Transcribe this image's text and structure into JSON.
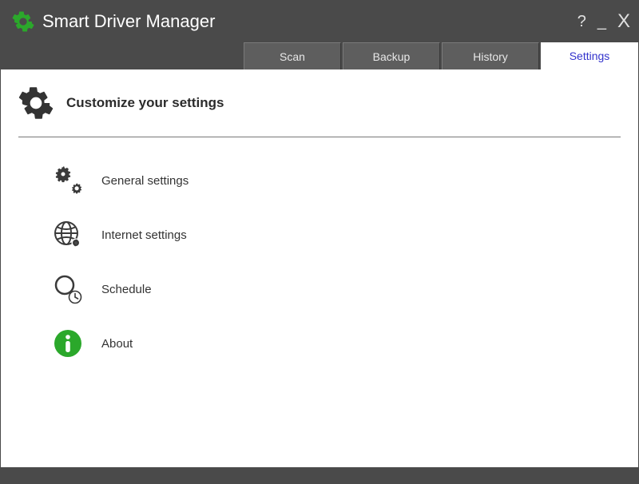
{
  "app": {
    "title": "Smart Driver Manager"
  },
  "tabs": {
    "scan": "Scan",
    "backup": "Backup",
    "history": "History",
    "settings": "Settings"
  },
  "page": {
    "heading": "Customize your settings"
  },
  "settings_items": {
    "general": "General settings",
    "internet": "Internet settings",
    "schedule": "Schedule",
    "about": "About"
  },
  "colors": {
    "accent_green": "#2ba82b",
    "chrome_dark": "#4a4a4a",
    "active_tab_text": "#3333cc"
  }
}
